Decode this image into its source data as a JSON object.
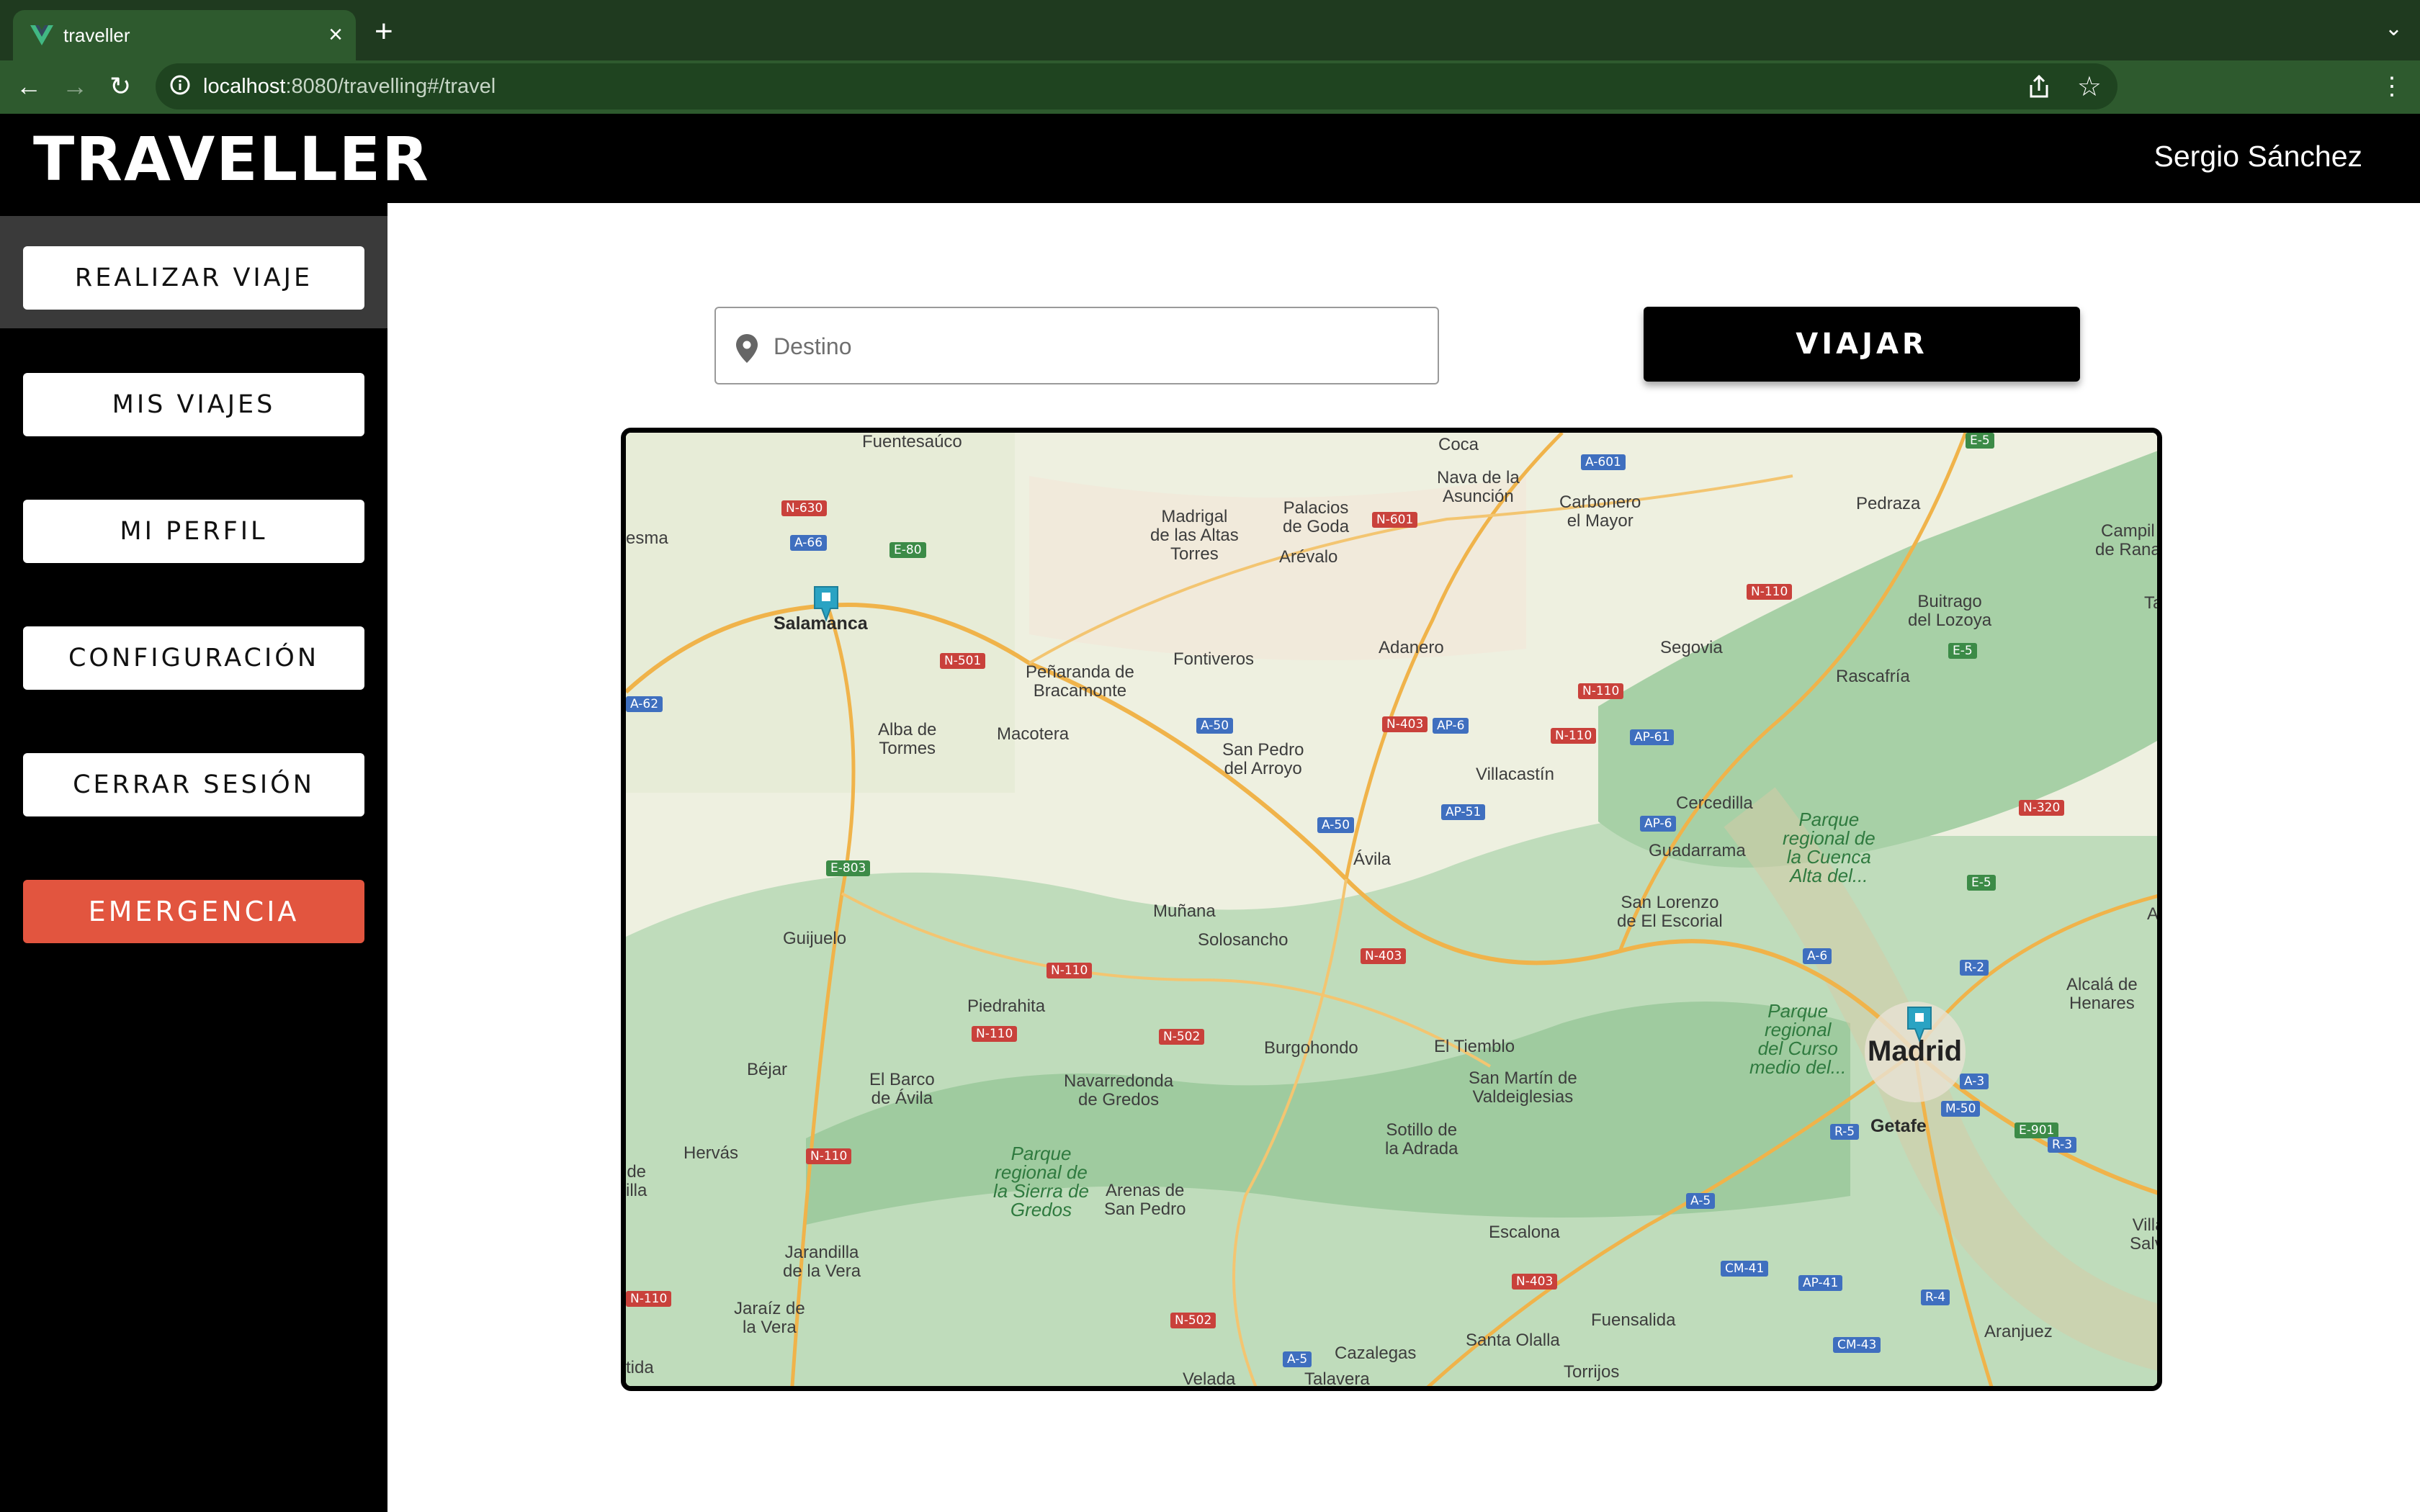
{
  "browser": {
    "tab_title": "traveller",
    "new_tab": "+",
    "url_host": "localhost",
    "url_path": ":8080/travelling#/travel"
  },
  "app": {
    "logo_text": "TRAVELLER",
    "user_name": "Sergio Sánchez"
  },
  "sidebar": {
    "items": [
      {
        "label": "REALIZAR VIAJE"
      },
      {
        "label": "MIS VIAJES"
      },
      {
        "label": "MI PERFIL"
      },
      {
        "label": "CONFIGURACIÓN"
      },
      {
        "label": "CERRAR SESIÓN"
      },
      {
        "label": "EMERGENCIA"
      }
    ],
    "active_index": 0
  },
  "main": {
    "destination_placeholder": "Destino",
    "destination_value": "",
    "travel_button": "VIAJAR"
  },
  "map": {
    "places": [
      "Coca",
      "Nava de la Asunción",
      "Palacios de Goda",
      "Madrigal de las Altas Torres",
      "Carbonero el Mayor",
      "Pedraza",
      "Campil de Rana",
      "Arévalo",
      "Buitrago del Lozoya",
      "Salamanca",
      "Peñaranda de Bracamonte",
      "Fontiveros",
      "Adanero",
      "Segovia",
      "Rascafría",
      "Alba de Tormes",
      "Macotera",
      "San Pedro del Arroyo",
      "Villacastín",
      "Cercedilla",
      "Guadarrama",
      "Parque regional de la Cuenca Alta del...",
      "Ávila",
      "San Lorenzo de El Escorial",
      "Muñana",
      "Solosancho",
      "Guijuelo",
      "Alcalá de Henares",
      "Piedrahita",
      "Burgohondo",
      "El Tiemblo",
      "Madrid",
      "Parque regional del Curso medio del...",
      "Béjar",
      "El Barco de Ávila",
      "Navarredonda de Gredos",
      "San Martín de Valdeiglesias",
      "Getafe",
      "Hervás",
      "Parque regional de la Sierra de Gredos",
      "Sotillo de la Adrada",
      "Arenas de San Pedro",
      "Escalona",
      "Jarandilla de la Vera",
      "Jaraíz de la Vera",
      "Fuensalida",
      "Santa Olalla",
      "Cazalegas",
      "Aranjuez",
      "Torrijos",
      "Velada",
      "Talavera",
      "esma",
      "Ta",
      "Al",
      "de illa",
      "Villar Salva",
      "tida",
      "Fuentesaúco"
    ],
    "roads": [
      "N-630",
      "A-66",
      "E-80",
      "N-601",
      "A-601",
      "N-110",
      "N-501",
      "E-5",
      "A-62",
      "A-50",
      "N-403",
      "AP-6",
      "AP-61",
      "AP-51",
      "E-803",
      "N-320",
      "R-2",
      "N-502",
      "A-3",
      "M-50",
      "R-5",
      "E-901",
      "R-3",
      "A-5",
      "CM-41",
      "AP-41",
      "R-4",
      "CM-43",
      "A-6"
    ],
    "markers": [
      "Salamanca",
      "Madrid"
    ]
  }
}
